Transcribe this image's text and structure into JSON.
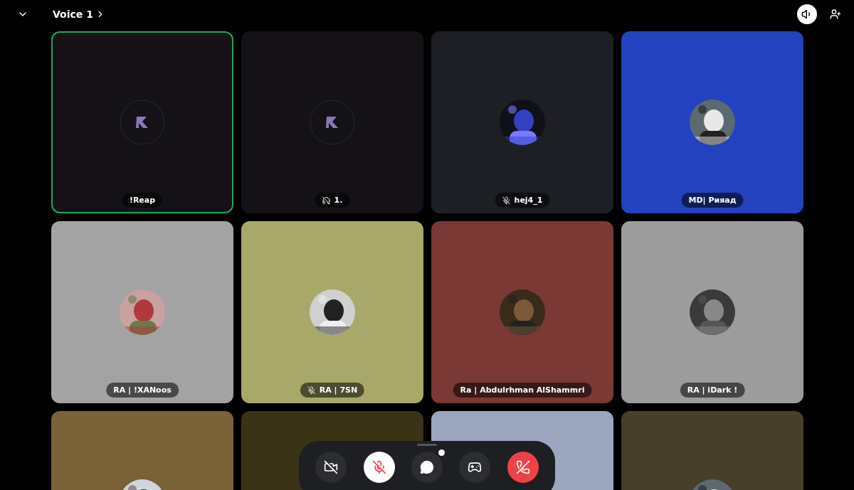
{
  "header": {
    "channel": "Voice 1"
  },
  "participants": [
    {
      "name": "!Reap",
      "muted": false,
      "deafened": false,
      "speaking": true,
      "color": "#141217",
      "avatar": {
        "kind": "logo"
      }
    },
    {
      "name": "1.",
      "muted": false,
      "deafened": true,
      "speaking": false,
      "color": "#141217",
      "avatar": {
        "kind": "logo"
      }
    },
    {
      "name": "hej4_1",
      "muted": true,
      "deafened": false,
      "speaking": false,
      "color": "#1e1f24"
    },
    {
      "name": "MD| Рияад",
      "muted": false,
      "deafened": false,
      "speaking": false,
      "color": "#2342bf"
    },
    {
      "name": "RA | !XANoos",
      "muted": false,
      "deafened": false,
      "speaking": false,
      "color": "#a3a3a3"
    },
    {
      "name": "RA | 7SN",
      "muted": true,
      "deafened": false,
      "speaking": false,
      "color": "#a8a86b"
    },
    {
      "name": "Ra | Abdulrhman AlShammri",
      "muted": false,
      "deafened": false,
      "speaking": false,
      "color": "#7b3935"
    },
    {
      "name": "RA | iDark !",
      "muted": false,
      "deafened": false,
      "speaking": false,
      "color": "#9c9c9c"
    },
    {
      "speaking": false,
      "color": "#7a6138"
    },
    {
      "speaking": false,
      "color": "#3b3315"
    },
    {
      "speaking": false,
      "color": "#9da6bf"
    },
    {
      "speaking": false,
      "color": "#46402b"
    }
  ],
  "controls": {
    "camera_on": false,
    "mic_muted": true,
    "chat_unread": true
  }
}
